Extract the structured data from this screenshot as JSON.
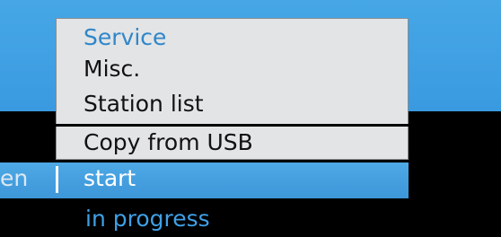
{
  "menu": {
    "header": "Service",
    "items": [
      "Misc.",
      "Station list",
      "Copy from USB"
    ]
  },
  "status": {
    "left_fragment": "en",
    "action": "start",
    "progress_text": "in progress"
  },
  "colors": {
    "screen_blue": "#3a9ae0",
    "panel_bg": "#e2e4e6",
    "header_text": "#2f86c9",
    "progress_text": "#3fa0e6"
  }
}
